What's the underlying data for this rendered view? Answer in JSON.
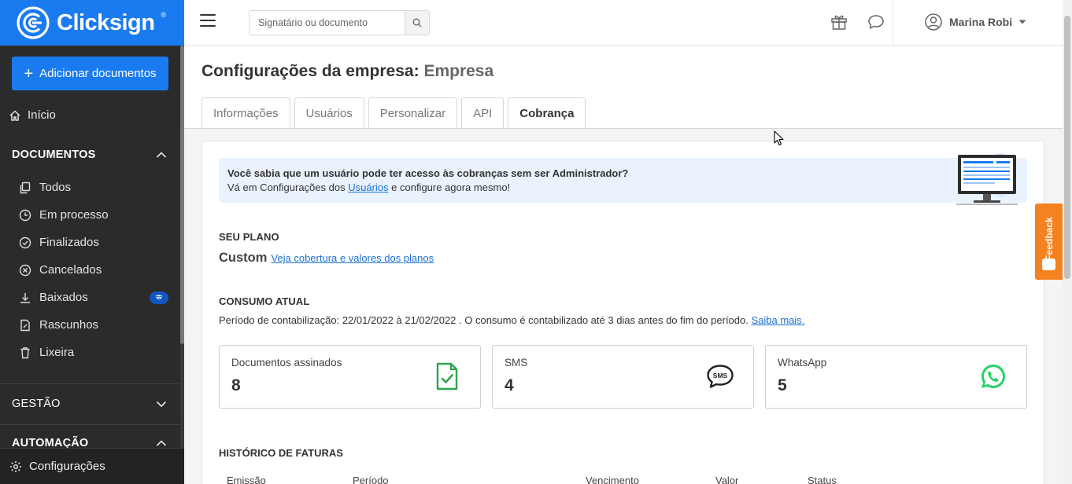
{
  "brand": {
    "name": "Clicksign",
    "reg": "®",
    "color": "#1a7bf0"
  },
  "sidebar": {
    "add_button": "Adicionar documentos",
    "home": "Início",
    "documents_section": "DOCUMENTOS",
    "doc_items": [
      {
        "label": "Todos",
        "icon": "copy-icon"
      },
      {
        "label": "Em processo",
        "icon": "clock-icon"
      },
      {
        "label": "Finalizados",
        "icon": "check-circle-icon"
      },
      {
        "label": "Cancelados",
        "icon": "x-circle-icon"
      },
      {
        "label": "Baixados",
        "icon": "download-icon",
        "premium": true
      },
      {
        "label": "Rascunhos",
        "icon": "draft-icon"
      },
      {
        "label": "Lixeira",
        "icon": "trash-icon"
      }
    ],
    "management_section": "GESTÃO",
    "automation_section": "AUTOMAÇÃO",
    "settings": "Configurações"
  },
  "topbar": {
    "search_placeholder": "Signatário ou documento",
    "user_name": "Marina Robi"
  },
  "page": {
    "title_prefix": "Configurações da empresa:",
    "title_company": "Empresa",
    "tabs": [
      {
        "label": "Informações",
        "active": false
      },
      {
        "label": "Usuários",
        "active": false
      },
      {
        "label": "Personalizar",
        "active": false
      },
      {
        "label": "API",
        "active": false
      },
      {
        "label": "Cobrança",
        "active": true
      }
    ]
  },
  "banner": {
    "title": "Você sabia que um usuário pode ter acesso às cobranças sem ser Administrador?",
    "text_before": "Vá em Configurações dos",
    "link": "Usuários",
    "text_after": "e configure agora mesmo!"
  },
  "plan": {
    "section": "SEU PLANO",
    "name": "Custom",
    "link": "Veja cobertura e valores dos planos"
  },
  "consumption": {
    "section": "CONSUMO ATUAL",
    "period_text": "Período de contabilização: 22/01/2022 à 21/02/2022 . O consumo é contabilizado até 3 dias antes do fim do período.",
    "period_link": "Saiba mais.",
    "stats": [
      {
        "label": "Documentos assinados",
        "value": "8",
        "icon": "document-check-icon"
      },
      {
        "label": "SMS",
        "value": "4",
        "icon": "sms-icon"
      },
      {
        "label": "WhatsApp",
        "value": "5",
        "icon": "whatsapp-icon"
      }
    ]
  },
  "invoices": {
    "section": "HISTÓRICO DE FATURAS",
    "columns": [
      "Emissão",
      "Período",
      "Vencimento",
      "Valor",
      "Status"
    ]
  },
  "feedback": {
    "label": "Feedback",
    "color": "#f58220"
  },
  "colors": {
    "green": "#2ea44f",
    "whatsapp": "#25d366"
  }
}
